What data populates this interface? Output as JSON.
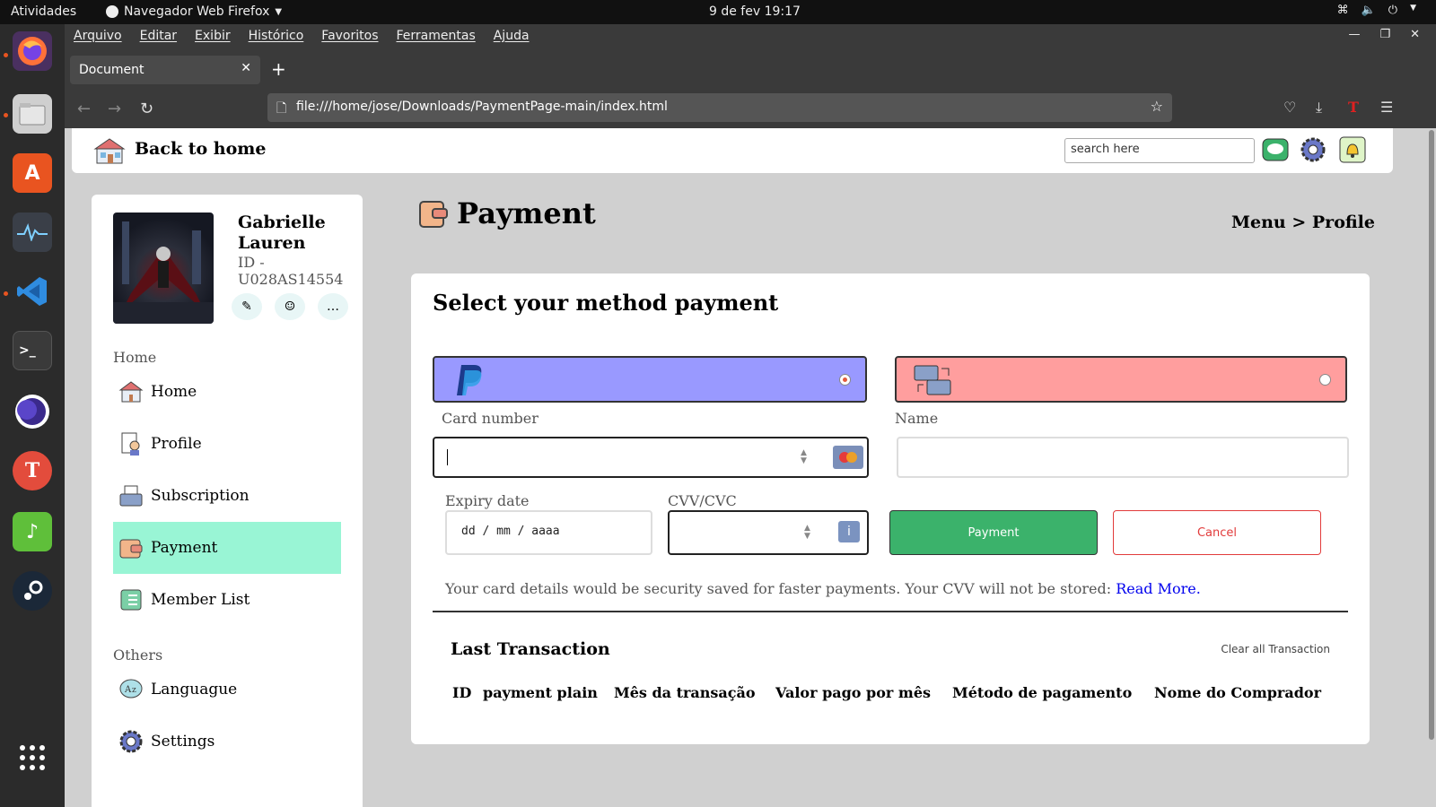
{
  "os": {
    "activities": "Atividades",
    "app_menu": "Navegador Web Firefox",
    "clock": "9 de fev  19:17"
  },
  "browser": {
    "menu": [
      "Arquivo",
      "Editar",
      "Exibir",
      "Histórico",
      "Favoritos",
      "Ferramentas",
      "Ajuda"
    ],
    "tab_title": "Document",
    "url": "file:///home/jose/Downloads/PaymentPage-main/index.html"
  },
  "header": {
    "back_label": "Back to home",
    "search_placeholder": "search here"
  },
  "profile": {
    "name": "Gabrielle Lauren",
    "id": "ID - U028AS14554"
  },
  "sidebar": {
    "section_home": "Home",
    "section_others": "Others",
    "items": [
      {
        "label": "Home"
      },
      {
        "label": "Profile"
      },
      {
        "label": "Subscription"
      },
      {
        "label": "Payment"
      },
      {
        "label": "Member List"
      },
      {
        "label": "Languague"
      },
      {
        "label": "Settings"
      }
    ]
  },
  "main": {
    "title": "Payment",
    "breadcrumb": "Menu > Profile",
    "heading": "Select your method payment",
    "card_number_label": "Card number",
    "name_label": "Name",
    "expiry_label": "Expiry date",
    "expiry_placeholder": "dd / mm / aaaa",
    "cvv_label": "CVV/CVC",
    "pay_button": "Payment",
    "cancel_button": "Cancel",
    "note": "Your card details would be security saved for faster payments. Your CVV will not be stored: ",
    "read_more": "Read More.",
    "last_transaction": "Last Transaction",
    "clear_all": "Clear all Transaction",
    "columns": [
      "ID",
      "payment plain",
      "Mês da transação",
      "Valor pago por mês",
      "Método de pagamento",
      "Nome do Comprador"
    ]
  },
  "colors": {
    "paypal_bg": "#9999ff",
    "transfer_bg": "#ff9e9e",
    "active_nav": "#99f5d5",
    "pay_button": "#3bb26b",
    "cancel_button": "#e23b3b"
  }
}
